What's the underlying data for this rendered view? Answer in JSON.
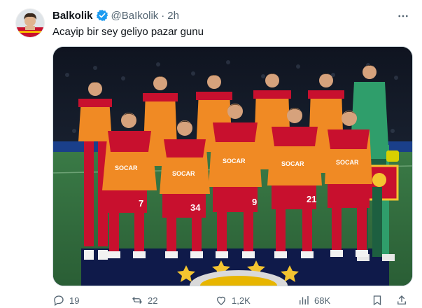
{
  "tweet": {
    "display_name": "Balkolik",
    "handle": "@BaIkolik",
    "separator": "·",
    "time": "2h",
    "text": "Acayip bir sey geliyo pazar gunu",
    "verified_color": "#1d9bf0"
  },
  "media": {
    "sponsor_text": "SOCAR",
    "shirt_numbers": [
      "7",
      "34",
      "9",
      "21"
    ],
    "colors": {
      "shirt_red": "#c8102e",
      "shirt_orange": "#f08a24",
      "keeper_green": "#2f9e6b",
      "pitch": "#2e6a3e"
    }
  },
  "actions": {
    "replies": "19",
    "reposts": "22",
    "likes": "1,2K",
    "views": "68K"
  },
  "icons": [
    "verified-badge-icon",
    "more-icon",
    "reply-icon",
    "repost-icon",
    "like-icon",
    "views-icon",
    "bookmark-icon",
    "share-icon"
  ]
}
